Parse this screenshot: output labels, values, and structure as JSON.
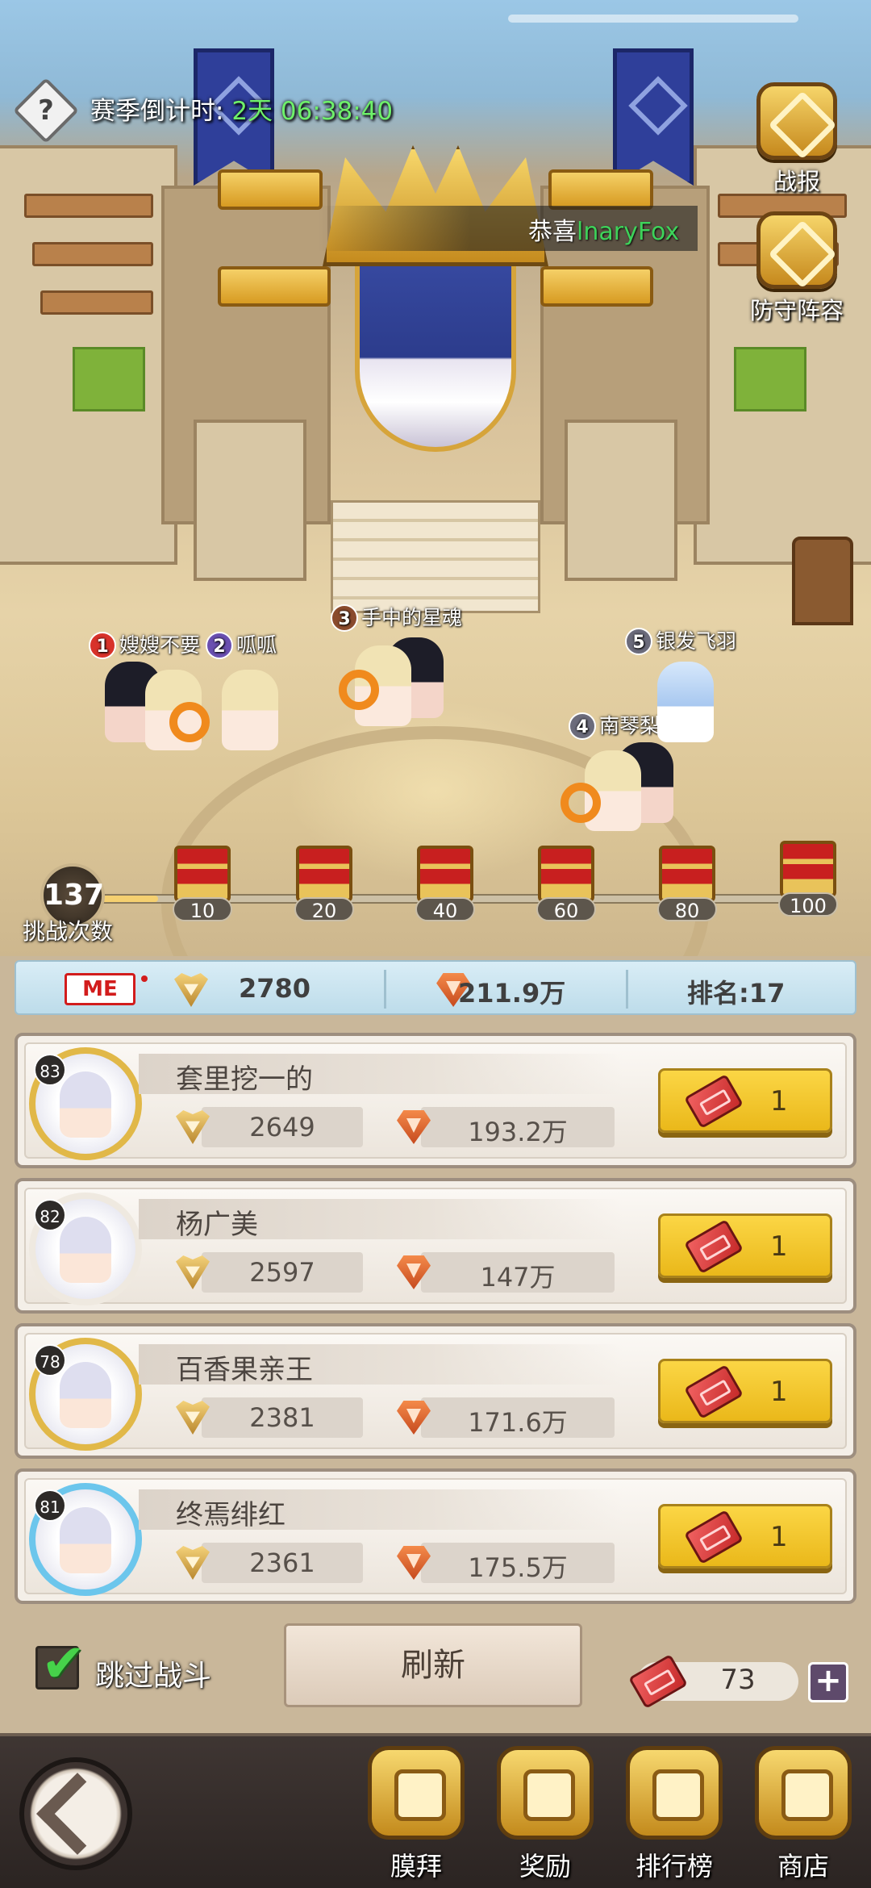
{
  "season": {
    "label": "赛季倒计时:",
    "time": "2天 06:38:40"
  },
  "congrats": {
    "prefix": "恭喜",
    "player": "lnaryFox"
  },
  "side_buttons": {
    "battle_report": "战报",
    "defense_lineup": "防守阵容"
  },
  "characters": [
    {
      "rank": "1",
      "name": "嫂嫂不要"
    },
    {
      "rank": "2",
      "name": "呱呱"
    },
    {
      "rank": "3",
      "name": "手中的星魂"
    },
    {
      "rank": "4",
      "name": "南琴梨"
    },
    {
      "rank": "5",
      "name": "银发飞羽"
    }
  ],
  "rank_colors": [
    "#d8322a",
    "#6a4fb0",
    "#8a4b2d",
    "#6b6b7b",
    "#6b6b7b"
  ],
  "challenges": {
    "count": "137",
    "label": "挑战次数",
    "milestones": [
      "10",
      "20",
      "40",
      "60",
      "80",
      "100"
    ],
    "progress_fraction": 0.12
  },
  "me": {
    "badge": "ME",
    "score": "2780",
    "power": "211.9万",
    "rank": "排名:17"
  },
  "opponents": [
    {
      "level": "83",
      "name": "套里挖一的",
      "score": "2649",
      "power": "193.2万",
      "cost": "1"
    },
    {
      "level": "82",
      "name": "杨广美",
      "score": "2597",
      "power": "147万",
      "cost": "1"
    },
    {
      "level": "78",
      "name": "百香果亲王",
      "score": "2381",
      "power": "171.6万",
      "cost": "1"
    },
    {
      "level": "81",
      "name": "终焉绯红",
      "score": "2361",
      "power": "175.5万",
      "cost": "1"
    }
  ],
  "controls": {
    "skip_label": "跳过战斗",
    "skip_checked": true,
    "refresh_label": "刷新",
    "tickets": "73",
    "add": "+"
  },
  "nav": {
    "worship": "膜拜",
    "rewards": "奖励",
    "leaderboard": "排行榜",
    "shop": "商店"
  },
  "icons": {
    "help": "?",
    "check": "✔"
  }
}
